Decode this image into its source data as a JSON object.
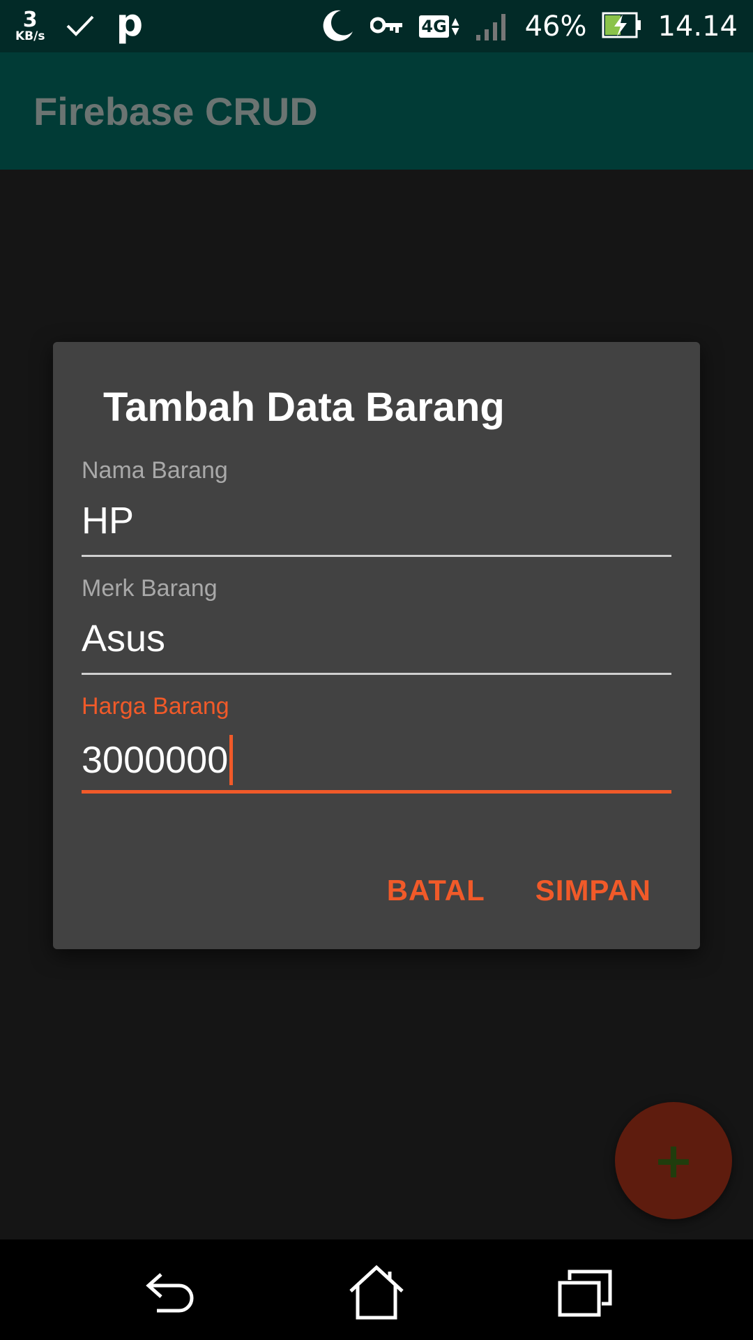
{
  "status_bar": {
    "net_speed_value": "3",
    "net_speed_unit": "KB/s",
    "app_letter": "p",
    "network_type": "4G",
    "battery_percent": "46%",
    "time": "14.14"
  },
  "app_bar": {
    "title": "Firebase CRUD"
  },
  "dialog": {
    "title": "Tambah Data Barang",
    "fields": [
      {
        "label": "Nama Barang",
        "value": "HP"
      },
      {
        "label": "Merk Barang",
        "value": "Asus"
      },
      {
        "label": "Harga Barang",
        "value": "3000000"
      }
    ],
    "cancel_label": "BATAL",
    "save_label": "SIMPAN"
  },
  "fab": {
    "symbol": "+"
  },
  "colors": {
    "accent": "#f15a29",
    "dialog_bg": "#424242",
    "app_bar_bg": "#013b36",
    "status_bar_bg": "#022a27",
    "screen_bg": "#151515"
  }
}
